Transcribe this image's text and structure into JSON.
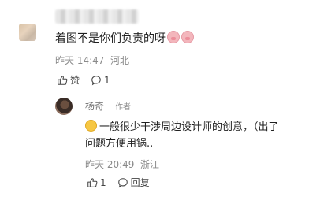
{
  "comment": {
    "text": "着图不是你们负责的呀",
    "time": "昨天 14:47",
    "location": "河北",
    "like_label": "赞",
    "reply_count": "1"
  },
  "reply": {
    "user_name": "杨奇",
    "author_tag": "作者",
    "line1": "一般很少干涉周边设计师的创意，（出了",
    "line2": "问题方便用锅..",
    "time": "昨天 20:49",
    "location": "浙江",
    "like_count": "1",
    "reply_label": "回复"
  }
}
